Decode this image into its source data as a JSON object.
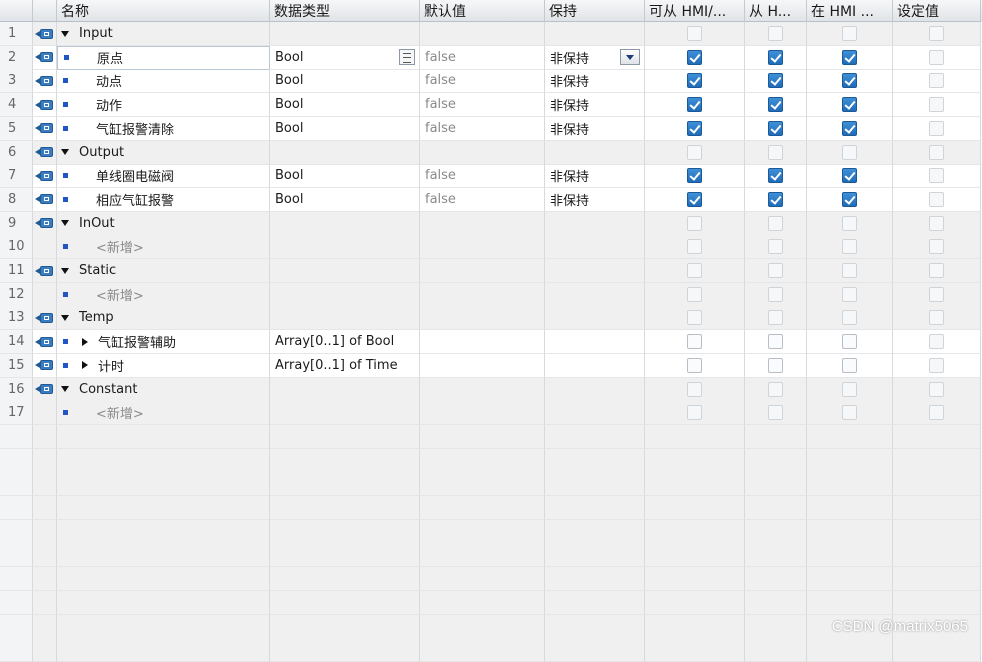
{
  "headers": {
    "name": "名称",
    "datatype": "数据类型",
    "default": "默认值",
    "retain": "保持",
    "hmi_access": "可从 HMI/...",
    "hmi_visible": "从 H...",
    "hmi_setpoint": "在 HMI ...",
    "setpoint": "设定值"
  },
  "rows": [
    {
      "num": "1",
      "name": "Input",
      "type": "",
      "default": "",
      "retain": "",
      "hmi1": false,
      "hmi2": false,
      "hmi3": false,
      "set": false
    },
    {
      "num": "2",
      "name": "原点",
      "type": "Bool",
      "default": "false",
      "retain": "非保持",
      "hmi1": true,
      "hmi2": true,
      "hmi3": true,
      "set": false
    },
    {
      "num": "3",
      "name": "动点",
      "type": "Bool",
      "default": "false",
      "retain": "非保持",
      "hmi1": true,
      "hmi2": true,
      "hmi3": true,
      "set": false
    },
    {
      "num": "4",
      "name": "动作",
      "type": "Bool",
      "default": "false",
      "retain": "非保持",
      "hmi1": true,
      "hmi2": true,
      "hmi3": true,
      "set": false
    },
    {
      "num": "5",
      "name": "气缸报警清除",
      "type": "Bool",
      "default": "false",
      "retain": "非保持",
      "hmi1": true,
      "hmi2": true,
      "hmi3": true,
      "set": false
    },
    {
      "num": "6",
      "name": "Output",
      "type": "",
      "default": "",
      "retain": "",
      "hmi1": false,
      "hmi2": false,
      "hmi3": false,
      "set": false
    },
    {
      "num": "7",
      "name": "单线圈电磁阀",
      "type": "Bool",
      "default": "false",
      "retain": "非保持",
      "hmi1": true,
      "hmi2": true,
      "hmi3": true,
      "set": false
    },
    {
      "num": "8",
      "name": "相应气缸报警",
      "type": "Bool",
      "default": "false",
      "retain": "非保持",
      "hmi1": true,
      "hmi2": true,
      "hmi3": true,
      "set": false
    },
    {
      "num": "9",
      "name": "InOut",
      "type": "",
      "default": "",
      "retain": "",
      "hmi1": false,
      "hmi2": false,
      "hmi3": false,
      "set": false
    },
    {
      "num": "10",
      "name": "<新增>",
      "type": "",
      "default": "",
      "retain": "",
      "hmi1": false,
      "hmi2": false,
      "hmi3": false,
      "set": false
    },
    {
      "num": "11",
      "name": "Static",
      "type": "",
      "default": "",
      "retain": "",
      "hmi1": false,
      "hmi2": false,
      "hmi3": false,
      "set": false
    },
    {
      "num": "12",
      "name": "<新增>",
      "type": "",
      "default": "",
      "retain": "",
      "hmi1": false,
      "hmi2": false,
      "hmi3": false,
      "set": false
    },
    {
      "num": "13",
      "name": "Temp",
      "type": "",
      "default": "",
      "retain": "",
      "hmi1": false,
      "hmi2": false,
      "hmi3": false,
      "set": false
    },
    {
      "num": "14",
      "name": "气缸报警辅助",
      "type": "Array[0..1] of Bool",
      "default": "",
      "retain": "",
      "hmi1": false,
      "hmi2": false,
      "hmi3": false,
      "set": false
    },
    {
      "num": "15",
      "name": "计时",
      "type": "Array[0..1] of Time",
      "default": "",
      "retain": "",
      "hmi1": false,
      "hmi2": false,
      "hmi3": false,
      "set": false
    },
    {
      "num": "16",
      "name": "Constant",
      "type": "",
      "default": "",
      "retain": "",
      "hmi1": false,
      "hmi2": false,
      "hmi3": false,
      "set": false
    },
    {
      "num": "17",
      "name": "<新增>",
      "type": "",
      "default": "",
      "retain": "",
      "hmi1": false,
      "hmi2": false,
      "hmi3": false,
      "set": false
    }
  ],
  "watermark": "CSDN @matrix5065"
}
